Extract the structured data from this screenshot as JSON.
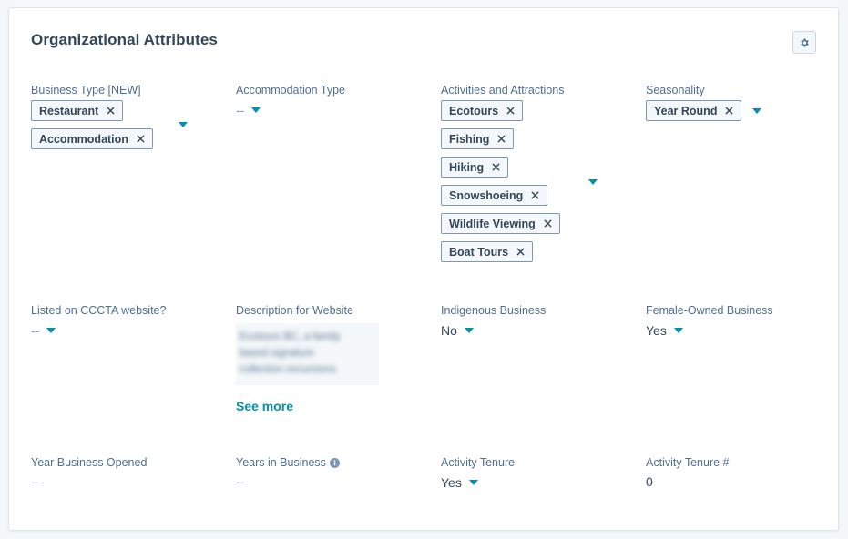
{
  "card": {
    "title": "Organizational Attributes"
  },
  "fields": {
    "business_type": {
      "label": "Business Type [NEW]",
      "tags": [
        "Restaurant",
        "Accommodation"
      ]
    },
    "accommodation_type": {
      "label": "Accommodation Type",
      "value": "--"
    },
    "activities": {
      "label": "Activities and Attractions",
      "tags": [
        "Ecotours",
        "Fishing",
        "Hiking",
        "Snowshoeing",
        "Wildlife Viewing",
        "Boat Tours"
      ]
    },
    "seasonality": {
      "label": "Seasonality",
      "tags": [
        "Year Round"
      ]
    },
    "listed_cccta": {
      "label": "Listed on CCCTA website?",
      "value": "--"
    },
    "description": {
      "label": "Description for Website",
      "blurred_lines": [
        "Ecotours BC, a family",
        "based signature",
        "collection excursions"
      ],
      "see_more": "See more"
    },
    "indigenous": {
      "label": "Indigenous Business",
      "value": "No"
    },
    "female_owned": {
      "label": "Female-Owned Business",
      "value": "Yes"
    },
    "year_opened": {
      "label": "Year Business Opened",
      "value": "--"
    },
    "years_in_business": {
      "label": "Years in Business",
      "value": "--"
    },
    "activity_tenure": {
      "label": "Activity Tenure",
      "value": "Yes"
    },
    "activity_tenure_num": {
      "label": "Activity Tenure #",
      "value": "0"
    }
  },
  "icons": {
    "settings": "gear-icon",
    "remove": "close-icon",
    "dropdown": "caret-down-icon",
    "info": "info-icon"
  },
  "colors": {
    "accent": "#0091ae",
    "text": "#33475b",
    "label": "#516f90",
    "tag_border": "#7c98b6",
    "card_border": "#dfe3eb",
    "page_bg": "#f5f8fa"
  }
}
